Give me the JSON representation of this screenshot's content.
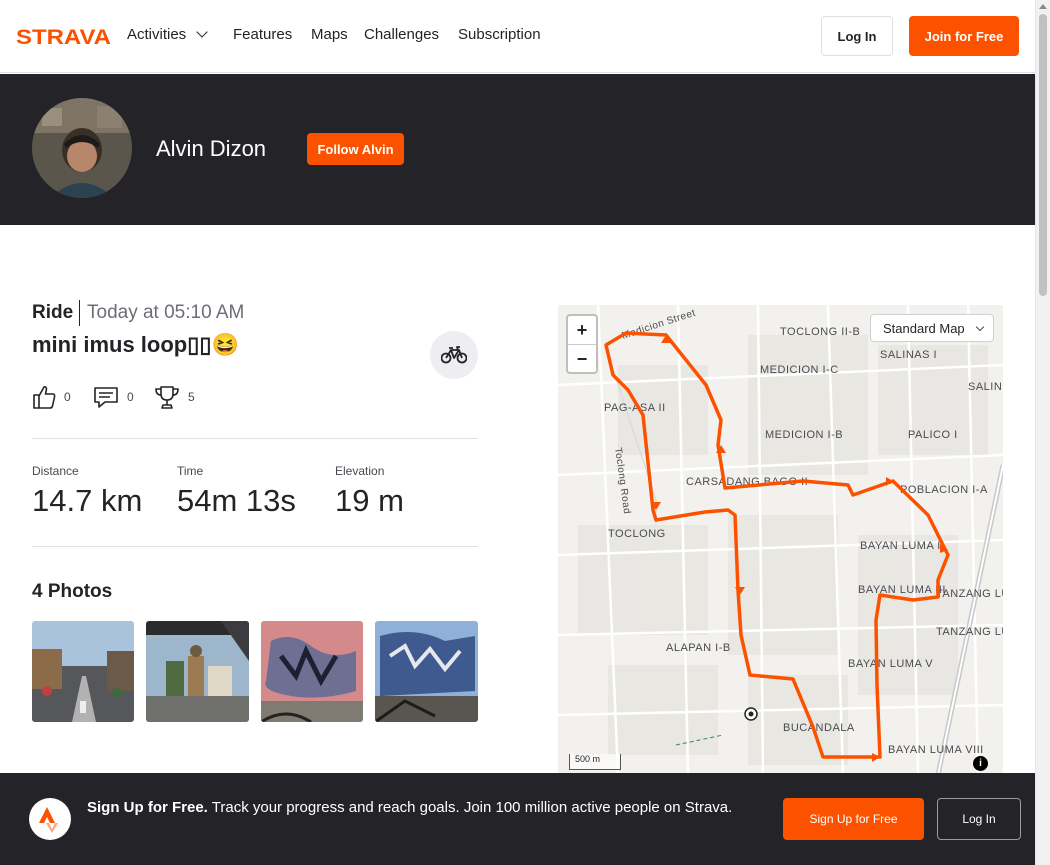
{
  "brand": {
    "logo_text": "STRAVA",
    "color": "#fc5200"
  },
  "nav": {
    "items": [
      {
        "label": "Activities",
        "has_dropdown": true
      },
      {
        "label": "Features"
      },
      {
        "label": "Maps"
      },
      {
        "label": "Challenges"
      },
      {
        "label": "Subscription"
      }
    ],
    "login_label": "Log In",
    "join_label": "Join for Free"
  },
  "athlete": {
    "name": "Alvin Dizon",
    "follow_label": "Follow Alvin"
  },
  "activity": {
    "type": "Ride",
    "date": "Today at 05:10 AM",
    "title": "mini imus loop▯▯😆",
    "sport_icon": "bike-icon",
    "kudos": "0",
    "comments": "0",
    "achievements": "5"
  },
  "stats": [
    {
      "label": "Distance",
      "value": "14.7 km"
    },
    {
      "label": "Time",
      "value": "54m 13s"
    },
    {
      "label": "Elevation",
      "value": "19 m"
    }
  ],
  "photos": {
    "title": "4 Photos",
    "count": 4
  },
  "map": {
    "style_label": "Standard Map",
    "zoom_in": "+",
    "zoom_out": "−",
    "scale_label": "500 m",
    "info_label": "i",
    "route_color": "#fc5200",
    "labels": [
      "Medicion Street",
      "TOCLONG II-B",
      "SALINAS I",
      "SALIN",
      "MEDICION I-C",
      "PAG-ASA II",
      "MEDICION I-B",
      "Toclong Road",
      "CARSADANG BAGO II",
      "POBLACION I-A",
      "PALICO I",
      "TOCLONG",
      "BAYAN LUMA I",
      "TANZANG LUMA III",
      "BAYAN LUMA III",
      "TANZANG LUMA IV",
      "ALAPAN I-B",
      "BAYAN LUMA V",
      "BUCANDALA",
      "BAYAN LUMA VIII"
    ]
  },
  "cta": {
    "headline": "Sign Up for Free.",
    "body": "Track your progress and reach goals. Join 100 million active people on Strava.",
    "signup_label": "Sign Up for Free",
    "login_label": "Log In"
  }
}
